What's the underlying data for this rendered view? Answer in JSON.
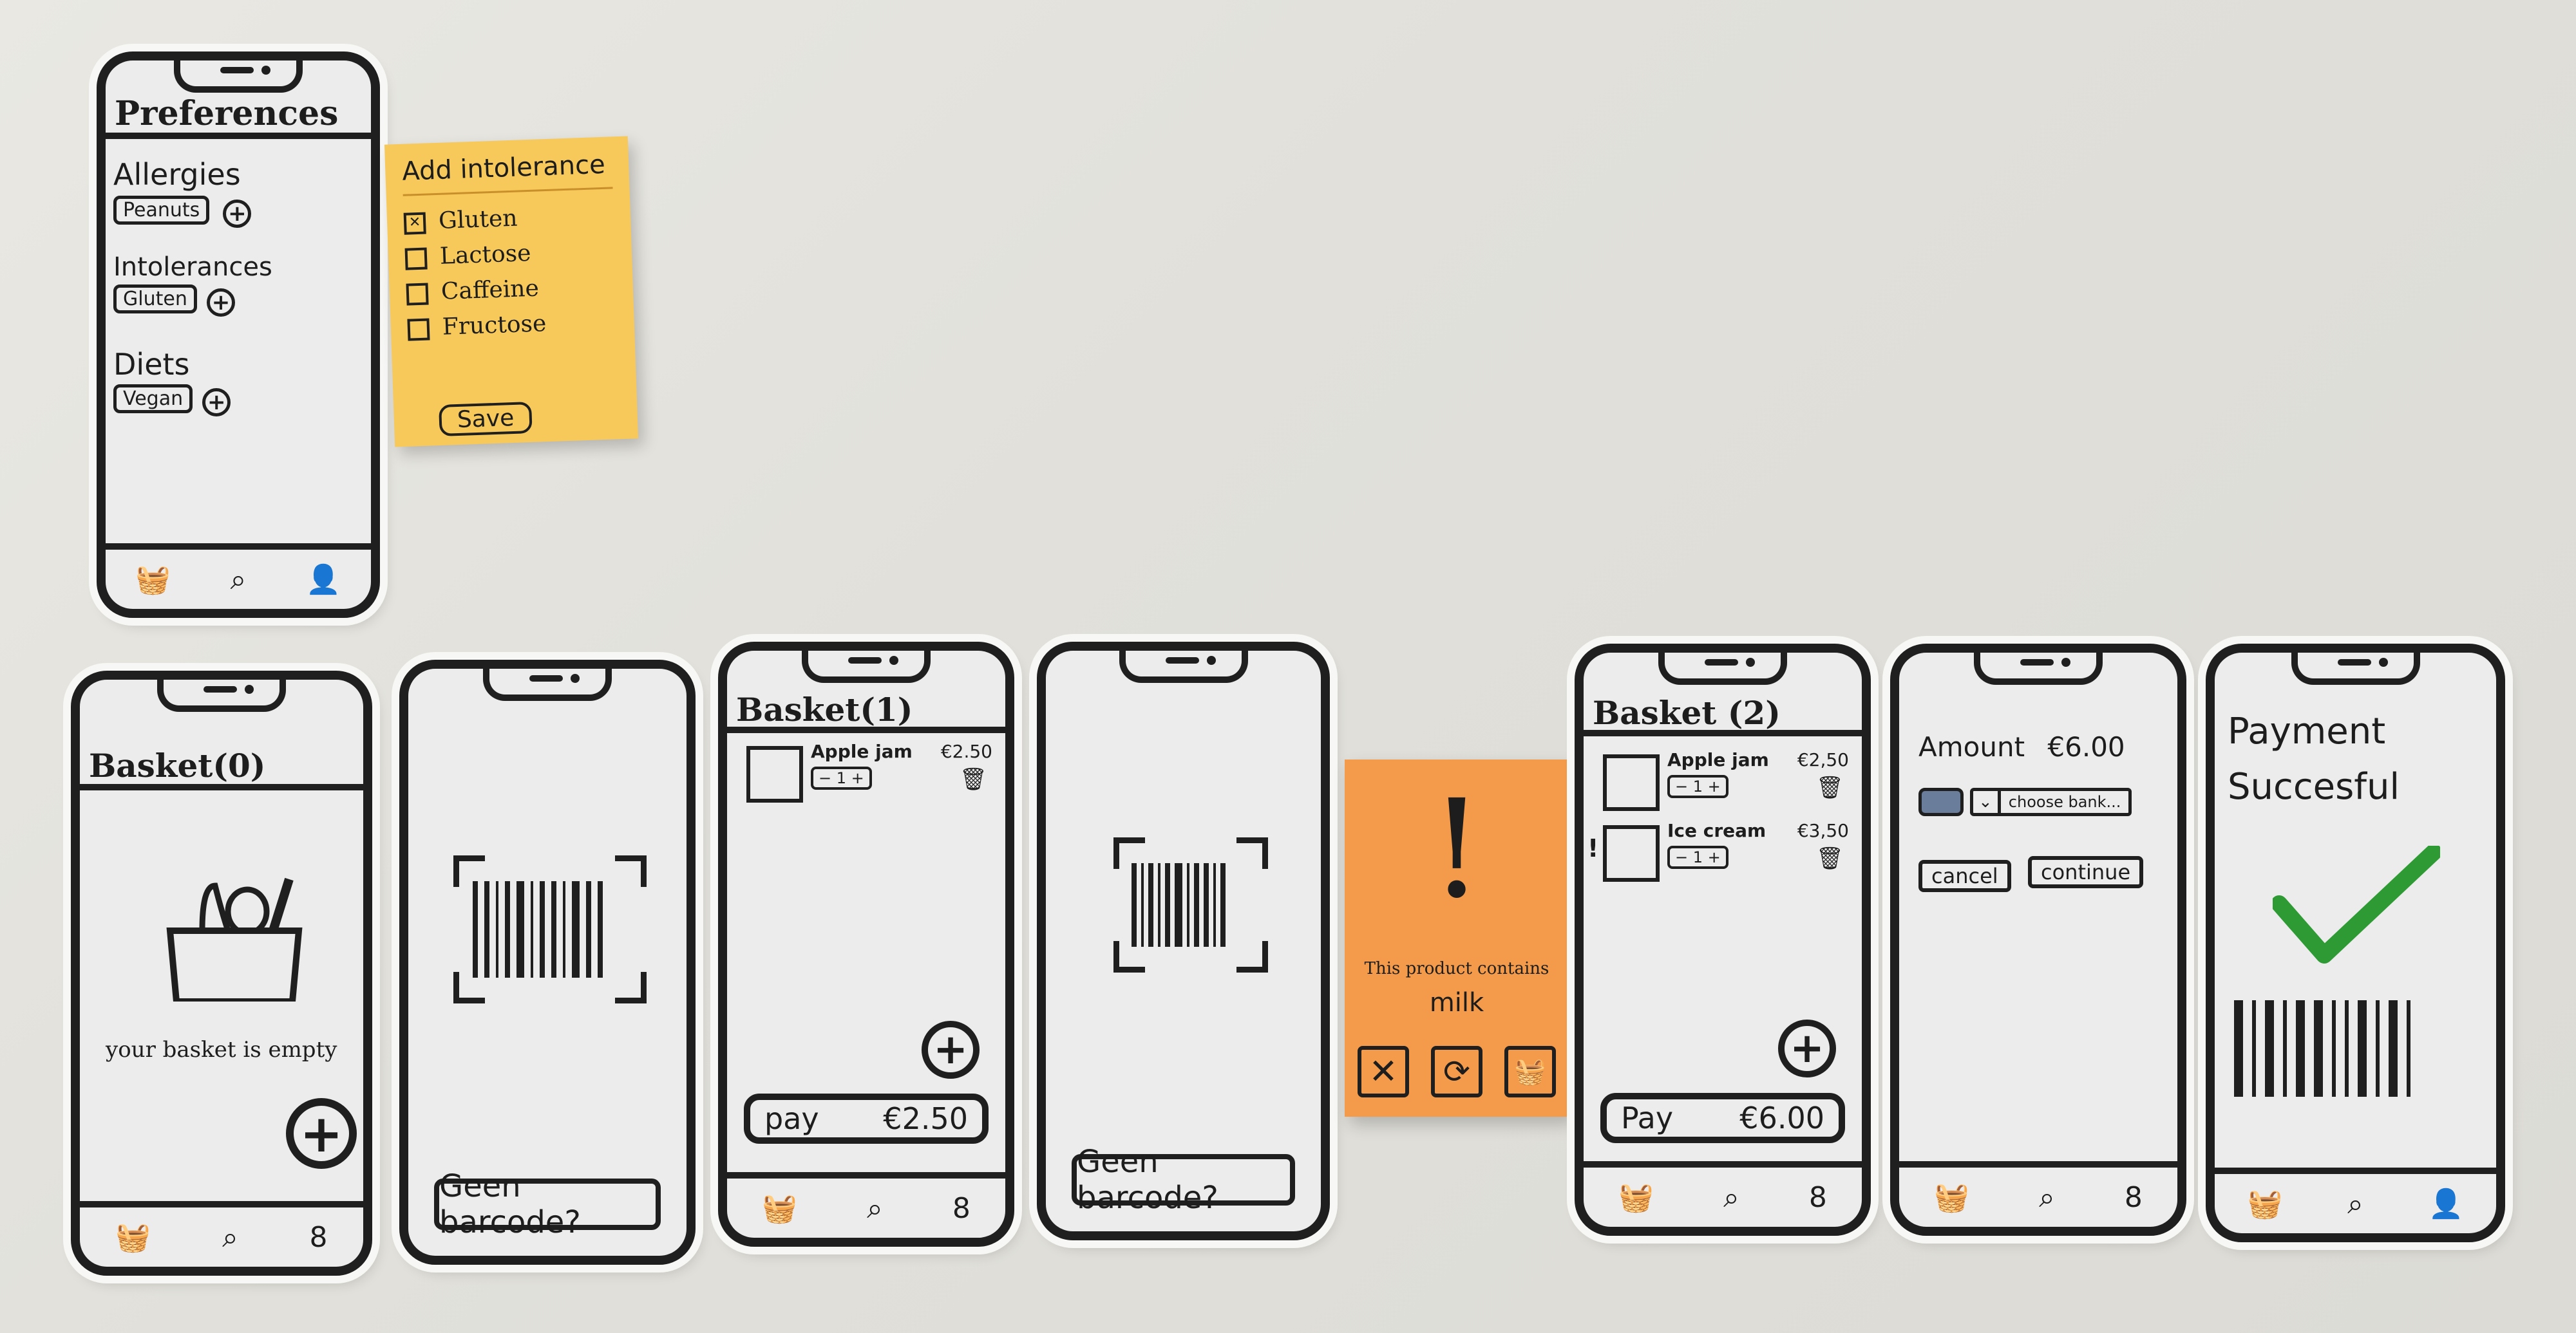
{
  "preferences": {
    "title": "Preferences",
    "allergies_label": "Allergies",
    "allergies_tag": "Peanuts",
    "intolerances_label": "Intolerances",
    "intolerances_tag": "Gluten",
    "diets_label": "Diets",
    "diets_tag": "Vegan",
    "add_symbol": "+"
  },
  "intolerance_note": {
    "title": "Add intolerance",
    "options": [
      {
        "label": "Gluten",
        "checked": true
      },
      {
        "label": "Lactose",
        "checked": false
      },
      {
        "label": "Caffeine",
        "checked": false
      },
      {
        "label": "Fructose",
        "checked": false
      }
    ],
    "save_label": "Save"
  },
  "basket_empty": {
    "title": "Basket(0)",
    "empty_text": "your basket is empty"
  },
  "scanner": {
    "no_barcode_label": "Geen barcode?"
  },
  "basket_one": {
    "title": "Basket(1)",
    "items": [
      {
        "name": "Apple jam",
        "price": "€2.50",
        "quantity": "1"
      }
    ],
    "pay_label": "pay",
    "pay_total": "€2.50"
  },
  "warning_note": {
    "mark": "!",
    "message": "This product contains",
    "allergen": "milk"
  },
  "basket_two": {
    "title": "Basket (2)",
    "items": [
      {
        "name": "Apple jam",
        "price": "€2,50",
        "quantity": "1"
      },
      {
        "name": "Ice cream",
        "price": "€3,50",
        "quantity": "1"
      }
    ],
    "warning_flag": "!",
    "pay_label": "Pay",
    "pay_total": "€6.00"
  },
  "payment": {
    "amount_label": "Amount",
    "amount_value": "€6.00",
    "bank_placeholder": "choose bank...",
    "cancel_label": "cancel",
    "continue_label": "continue"
  },
  "success": {
    "line1": "Payment",
    "line2": "Succesful",
    "check_color": "#2e9a34"
  },
  "nav": {
    "basket_icon": "basket-icon",
    "search_icon": "search-icon",
    "profile_icon": "profile-icon"
  },
  "colors": {
    "sticky_yellow": "#f7c85a",
    "sticky_orange": "#f39b4a",
    "ink": "#1f1f1f"
  }
}
